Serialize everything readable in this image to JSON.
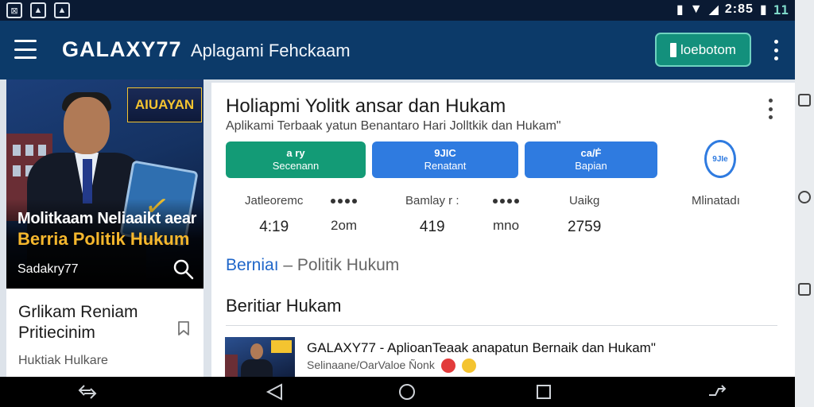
{
  "status_bar": {
    "time": "2:85",
    "battery_level": "11",
    "left_icons": [
      "image-icon",
      "gallery-icon",
      "gallery-icon"
    ],
    "right_icons": [
      "vibrate-icon",
      "wifi-icon",
      "signal-icon",
      "battery-icon"
    ]
  },
  "app_bar": {
    "brand": "GALAXY77",
    "subtitle": "Aplagami Fehckaam",
    "action_button_label": "loebotom",
    "colors": {
      "background": "#0c3a69",
      "action": "#13907c"
    }
  },
  "left_card": {
    "hero_badge": "AIUAYAN",
    "hero_line1": "Molitkaam Neliaaikt aear",
    "hero_line2": "Berria Politik Hukum",
    "hero_brand": "Sadakry77",
    "title": "Grlikam Reniam Pritiecinim",
    "subtitle": "Huktiak Hulkare"
  },
  "main_card": {
    "title": "Holiapmi Yolitk ansar dan Hukam",
    "subtitle": "Aplikami Terbaak yatun Benantaro Hari Jolltkik dan Hukam\"",
    "buttons": [
      {
        "icon_label": "a ry",
        "label": "Secenann",
        "color": "#139b76"
      },
      {
        "icon_label": "9JIC",
        "label": "Renatant",
        "color": "#2f7be0"
      },
      {
        "icon_label": "ca/Ḟ",
        "label": "Bapian",
        "color": "#2f7be0"
      }
    ],
    "circle_icon_label": "9JIe",
    "stats": [
      {
        "label": "Jatleoremc",
        "value": "4:19"
      },
      {
        "label": "Bamlay r :",
        "value": "419"
      },
      {
        "label": "Uaikg",
        "value": "2759"
      },
      {
        "label": "Mlinatadı",
        "value": ""
      }
    ],
    "units": [
      "2om",
      "mno"
    ],
    "breadcrumb": {
      "link": "Berniaı",
      "rest": " – Politik Hukum"
    },
    "section_title": "Beritiar Hukam",
    "news_item": {
      "title": "GALAXY77 - AplioanTeaak anapatun Bernaik dan Hukam\"",
      "meta": "Selinaane/OarValoe Ñonk"
    }
  }
}
